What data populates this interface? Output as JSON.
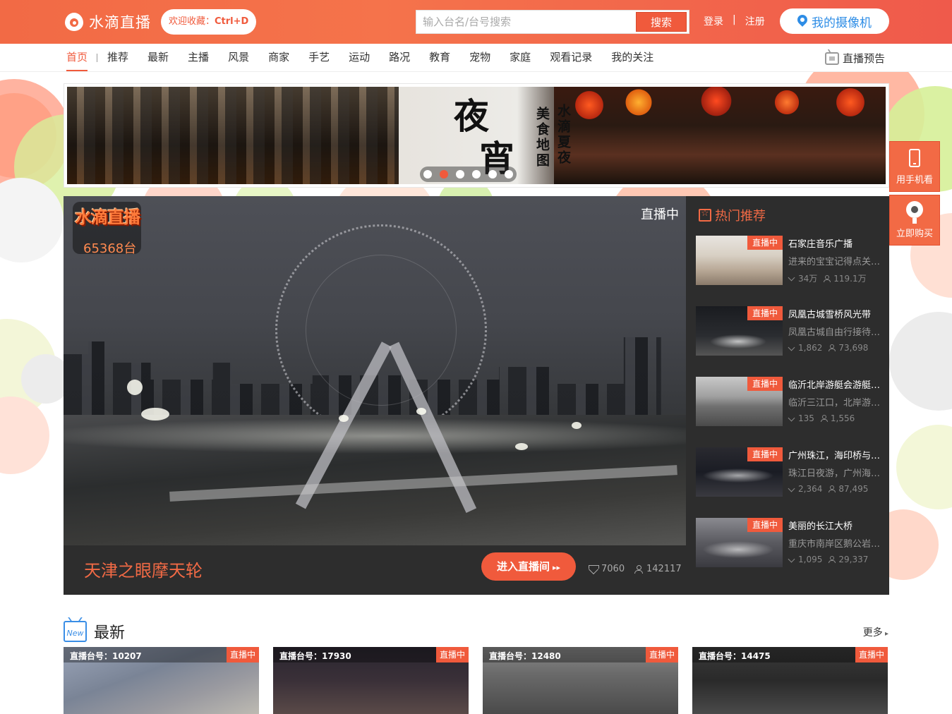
{
  "header": {
    "logo_text": "水滴直播",
    "fav_prefix": "欢迎收藏：",
    "fav_shortcut": "Ctrl+D",
    "search_placeholder": "输入台名/台号搜索",
    "search_button": "搜索",
    "login": "登录",
    "divider": "|",
    "register": "注册",
    "my_camera": "我的摄像机"
  },
  "nav": {
    "items": [
      "首页",
      "推荐",
      "最新",
      "主播",
      "风景",
      "商家",
      "手艺",
      "运动",
      "路况",
      "教育",
      "宠物",
      "家庭",
      "观看记录",
      "我的关注"
    ],
    "active_index": 0,
    "preview": "直播预告"
  },
  "banner": {
    "big_char_1": "夜",
    "big_char_2": "宵",
    "col_1": "水滴夏夜",
    "col_2": "美食地图",
    "dots_count": 6,
    "active_dot": 1
  },
  "side": {
    "mobile_watch": "用手机看",
    "buy_now": "立即购买"
  },
  "player": {
    "badge_logo": "水滴直播",
    "badge_count": "65368台",
    "live_tag": "直播中",
    "title": "天津之眼摩天轮",
    "enter_button": "进入直播间",
    "enter_arrows": "▸▸",
    "diamonds": "7060",
    "viewers": "142117"
  },
  "hot": {
    "heading": "热门推荐",
    "live_label": "直播中",
    "items": [
      {
        "name": "石家庄音乐广播",
        "desc": "进来的宝宝记得点关注哦",
        "diamonds": "34万",
        "viewers": "119.1万"
      },
      {
        "name": "凤凰古城雪桥风光带",
        "desc": "凤凰古城自由行接待中心",
        "diamonds": "1,862",
        "viewers": "73,698"
      },
      {
        "name": "临沂北岸游艇会游艇码头",
        "desc": "临沂三江口，北岸游艇会",
        "diamonds": "135",
        "viewers": "1,556"
      },
      {
        "name": "广州珠江，海印桥与二沙岛",
        "desc": "珠江日夜游，广州海印桥",
        "diamonds": "2,364",
        "viewers": "87,495"
      },
      {
        "name": "美丽的长江大桥",
        "desc": "重庆市南岸区鹅公岩大桥",
        "diamonds": "1,095",
        "viewers": "29,337"
      }
    ]
  },
  "latest": {
    "icon_text": "New",
    "title": "最新",
    "more": "更多",
    "live_label": "直播中",
    "cards": [
      {
        "id_label": "直播台号：10207"
      },
      {
        "id_label": "直播台号：17930"
      },
      {
        "id_label": "直播台号：12480"
      },
      {
        "id_label": "直播台号：14475"
      }
    ]
  },
  "colors": {
    "brand_orange": "#f26a45",
    "accent_red": "#f05a3c",
    "camera_blue": "#2e8de6",
    "dark_panel": "#2d2d2d"
  }
}
